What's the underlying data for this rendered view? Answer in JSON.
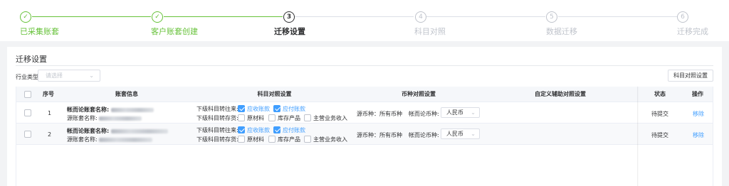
{
  "steps": [
    {
      "num": "1",
      "label": "已采集账套",
      "state": "done"
    },
    {
      "num": "2",
      "label": "客户账套创建",
      "state": "done"
    },
    {
      "num": "3",
      "label": "迁移设置",
      "state": "active"
    },
    {
      "num": "4",
      "label": "科目对照",
      "state": "pending"
    },
    {
      "num": "5",
      "label": "数据迁移",
      "state": "pending"
    },
    {
      "num": "6",
      "label": "迁移完成",
      "state": "pending"
    }
  ],
  "icons": {
    "check": "✓",
    "chevron": "⌄"
  },
  "panel": {
    "title": "迁移设置",
    "industry_label": "行业类型",
    "industry_placeholder": "请选择",
    "map_button": "科目对照设置"
  },
  "table": {
    "headers": {
      "index": "序号",
      "account_info": "账套信息",
      "subject_map": "科目对照设置",
      "currency_map": "币种对照设置",
      "custom_map": "自定义辅助对照设置",
      "status": "状态",
      "action": "操作"
    },
    "rows": [
      {
        "index": "1",
        "target_label": "帐而论账套名称:",
        "source_label": "源账套名称:",
        "line1_label": "下级科目转往来:",
        "line1_opt1": "应收账款",
        "line1_opt2": "应付账款",
        "line2_label": "下级科目转存货:",
        "line2_opt1": "原材料",
        "line2_opt2": "库存产品",
        "line2_opt3": "主营业务收入",
        "source_currency": "源币种：所有币种",
        "target_currency_label": "帐而论币种:",
        "target_currency": "人民币",
        "status": "待提交",
        "action": "移除"
      },
      {
        "index": "2",
        "target_label": "帐而论账套名称:",
        "source_label": "源账套名称:",
        "line1_label": "下级科目转往来:",
        "line1_opt1": "应收账款",
        "line1_opt2": "应付账款",
        "line2_label": "下级科目转存货:",
        "line2_opt1": "原材料",
        "line2_opt2": "库存产品",
        "line2_opt3": "主营业务收入",
        "source_currency": "源币种：所有币种",
        "target_currency_label": "帐而论币种:",
        "target_currency": "人民币",
        "status": "待提交",
        "action": "移除"
      }
    ]
  },
  "colors": {
    "success": "#67c23a",
    "primary": "#409eff",
    "text": "#303133",
    "muted": "#c0c4cc"
  }
}
